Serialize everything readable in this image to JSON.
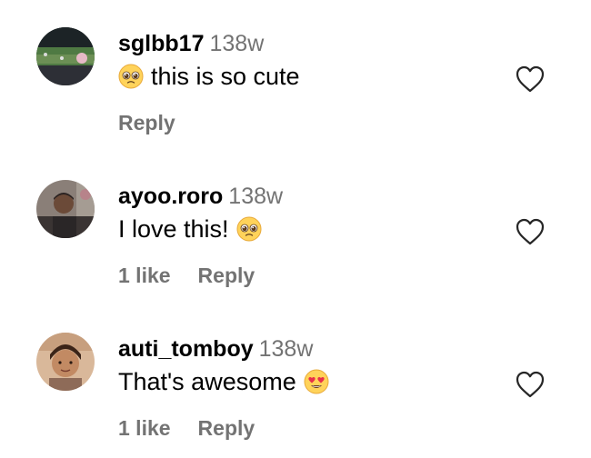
{
  "comments": [
    {
      "username": "sglbb17",
      "time": "138w",
      "text": "this is so cute",
      "emoji_position": "before",
      "emoji": "pleading-face",
      "likes": "",
      "reply_label": "Reply"
    },
    {
      "username": "ayoo.roro",
      "time": "138w",
      "text": "I love this!",
      "emoji_position": "after",
      "emoji": "pleading-face",
      "likes": "1 like",
      "reply_label": "Reply"
    },
    {
      "username": "auti_tomboy",
      "time": "138w",
      "text": "That's awesome",
      "emoji_position": "after",
      "emoji": "heart-eyes-face",
      "likes": "1 like",
      "reply_label": "Reply"
    }
  ],
  "colors": {
    "text": "#000000",
    "secondary": "#737373",
    "background": "#ffffff"
  },
  "icons": {
    "like": "heart-outline-icon"
  }
}
